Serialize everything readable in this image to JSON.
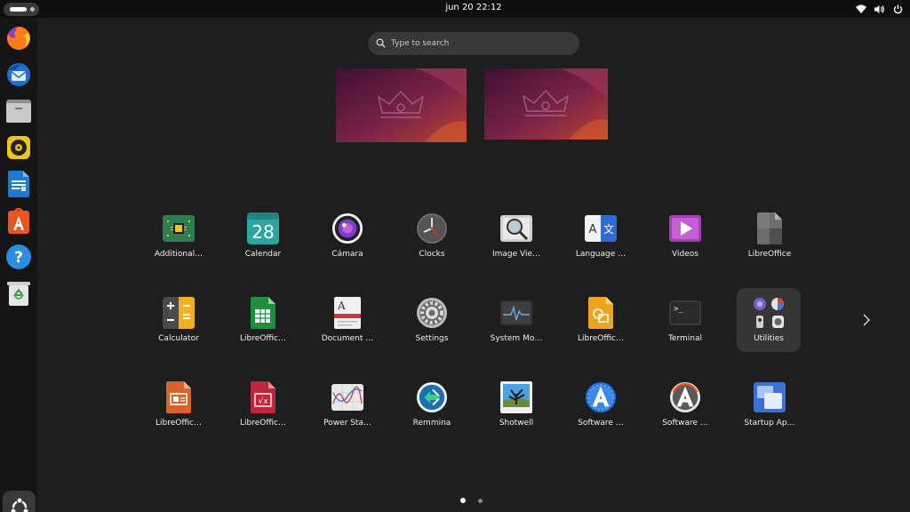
{
  "topbar": {
    "clock": "jun 20  22:12",
    "tray_icons": [
      "wifi-icon",
      "volume-icon",
      "power-icon"
    ]
  },
  "dock": {
    "items": [
      "firefox",
      "thunderbird",
      "files",
      "rhythmbox",
      "libreoffice-writer",
      "app-center",
      "help",
      "trash"
    ],
    "show_apps_icon": "ubuntu-logo-icon"
  },
  "search": {
    "placeholder": "Type to search"
  },
  "apps": [
    {
      "label": "Additional…",
      "icon": "chip-icon"
    },
    {
      "label": "Calendar",
      "icon": "calendar-icon",
      "icon_text": "28"
    },
    {
      "label": "Cámara",
      "icon": "camera-icon"
    },
    {
      "label": "Clocks",
      "icon": "clock-icon"
    },
    {
      "label": "Image Vie…",
      "icon": "image-viewer-icon"
    },
    {
      "label": "Language …",
      "icon": "language-icon",
      "icon_text_a": "A",
      "icon_text_b": "文"
    },
    {
      "label": "Videos",
      "icon": "videos-icon"
    },
    {
      "label": "LibreOffice",
      "icon": "libreoffice-icon"
    },
    {
      "label": "Calculator",
      "icon": "calculator-icon"
    },
    {
      "label": "LibreOffic…",
      "icon": "libreoffice-calc-icon"
    },
    {
      "label": "Document …",
      "icon": "document-viewer-icon",
      "icon_text": "A"
    },
    {
      "label": "Settings",
      "icon": "settings-icon"
    },
    {
      "label": "System Mo…",
      "icon": "system-monitor-icon"
    },
    {
      "label": "LibreOffic…",
      "icon": "libreoffice-draw-icon"
    },
    {
      "label": "Terminal",
      "icon": "terminal-icon",
      "icon_text": ">_"
    },
    {
      "label": "Utilities",
      "icon": "folder-icon",
      "folder": true
    },
    {
      "label": "LibreOffic…",
      "icon": "libreoffice-impress-icon"
    },
    {
      "label": "LibreOffic…",
      "icon": "libreoffice-math-icon",
      "icon_text": "√x"
    },
    {
      "label": "Power Sta…",
      "icon": "power-statistics-icon"
    },
    {
      "label": "Remmina",
      "icon": "remmina-icon"
    },
    {
      "label": "Shotwell",
      "icon": "shotwell-icon"
    },
    {
      "label": "Software …",
      "icon": "software-icon"
    },
    {
      "label": "Software …",
      "icon": "software-updater-icon"
    },
    {
      "label": "Startup Ap…",
      "icon": "startup-apps-icon"
    }
  ],
  "pager": {
    "pages": 2,
    "current": 1
  },
  "colors": {
    "accent": "#e95420",
    "wallpaper_dark": "#4a1436",
    "wallpaper_mid": "#8b2a52",
    "wallpaper_hot": "#c0442e"
  }
}
